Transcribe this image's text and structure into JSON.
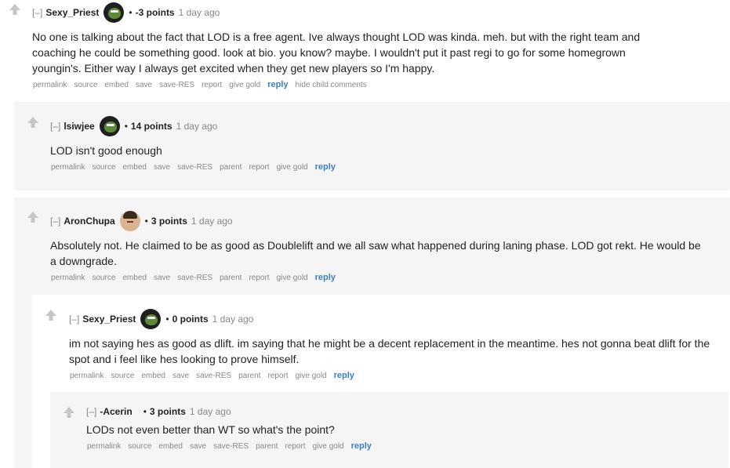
{
  "comments": [
    {
      "collapse": "[–]",
      "author": "Sexy_Priest",
      "bullet": "•",
      "score": "-3 points",
      "time": "1 day ago",
      "body": "No one is talking about the fact that LOD is a free agent. Ive always thought LOD was kinda. meh. but with the right team and coaching he could be something good. look at bio. you know? maybe. I wouldn't put it past regi to go for some homegrown youngin's. Either way I always get excited when they get new players so I'm happy.",
      "buttons": [
        "permalink",
        "source",
        "embed",
        "save",
        "save-RES",
        "report",
        "give gold"
      ],
      "reply": "reply",
      "extra": "hide child comments"
    },
    {
      "collapse": "[–]",
      "author": "lsiwjee",
      "bullet": "•",
      "score": "14 points",
      "time": "1 day ago",
      "body": "LOD isn't good enough",
      "buttons": [
        "permalink",
        "source",
        "embed",
        "save",
        "save-RES",
        "parent",
        "report",
        "give gold"
      ],
      "reply": "reply"
    },
    {
      "collapse": "[–]",
      "author": "AronChupa",
      "bullet": "•",
      "score": "3 points",
      "time": "1 day ago",
      "body": "Absolutely not. He claimed to be as good as Doublelift and we all saw what happened during laning phase. LOD got rekt. He would be a downgrade.",
      "buttons": [
        "permalink",
        "source",
        "embed",
        "save",
        "save-RES",
        "parent",
        "report",
        "give gold"
      ],
      "reply": "reply"
    },
    {
      "collapse": "[–]",
      "author": "Sexy_Priest",
      "bullet": "•",
      "score": "0 points",
      "time": "1 day ago",
      "body": "im not saying hes as good as dlift. im saying that he might be a decent replacement in the meantime. hes not gonna beat dlift for the spot and i feel like hes looking to prove himself.",
      "buttons": [
        "permalink",
        "source",
        "embed",
        "save",
        "save-RES",
        "parent",
        "report",
        "give gold"
      ],
      "reply": "reply"
    },
    {
      "collapse": "[–]",
      "author": "-Acerin",
      "bullet": "•",
      "score": "3 points",
      "time": "1 day ago",
      "body": "LODs not even better than WT so what's the point?",
      "buttons": [
        "permalink",
        "source",
        "embed",
        "save",
        "save-RES",
        "parent",
        "report",
        "give gold"
      ],
      "reply": "reply"
    }
  ],
  "colors": {
    "reply": "#3b7fc4",
    "muted": "#888888",
    "nested_bg": "#f5f5f5",
    "arrow": "#c6c6c6"
  },
  "icons": {
    "upvote": "upvote-arrow-icon",
    "avatar_frog": "frog-avatar-icon",
    "avatar_face": "face-avatar-icon"
  }
}
